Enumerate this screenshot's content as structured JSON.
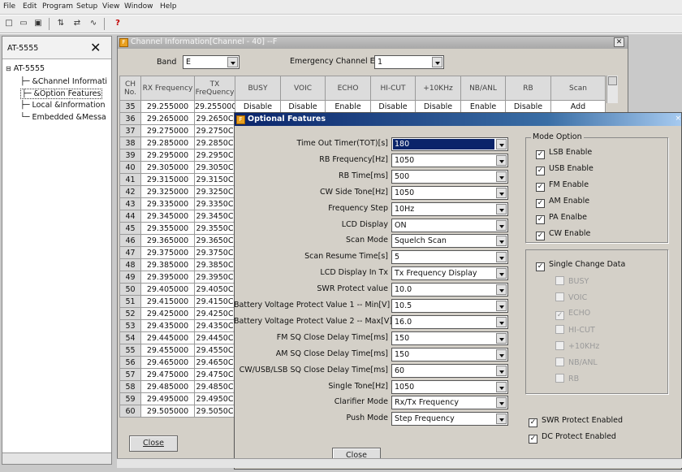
{
  "menu": [
    "File",
    "Edit",
    "Program",
    "Setup",
    "View",
    "Window",
    "Help"
  ],
  "toolbar_icons": [
    "new-icon",
    "open-icon",
    "save-icon",
    "read-icon",
    "write-icon",
    "wave-icon",
    "help-icon"
  ],
  "tree": {
    "title": "AT-5555",
    "root": "AT-5555",
    "items": [
      "&Channel Informati",
      "&Option Features",
      "Local &Information",
      "Embedded &Messa"
    ]
  },
  "channel_window": {
    "title": "Channel Information[Channel - 40] --F",
    "band_label": "Band",
    "band_value": "E",
    "emergency_label": "Emergency Channel E",
    "emergency_value": "1",
    "columns": [
      "CH No.",
      "RX Frequency",
      "TX FreQuency",
      "BUSY",
      "VOIC",
      "ECHO",
      "HI-CUT",
      "+10KHz",
      "NB/ANL",
      "RB",
      "Scan"
    ],
    "first_row_flags": [
      "Disable",
      "Disable",
      "Enable",
      "Disable",
      "Disable",
      "Enable",
      "Disable",
      "Add"
    ],
    "rows": [
      [
        "35",
        "29.255000",
        "29.255000"
      ],
      [
        "36",
        "29.265000",
        "29.2650C"
      ],
      [
        "37",
        "29.275000",
        "29.2750C"
      ],
      [
        "38",
        "29.285000",
        "29.2850C"
      ],
      [
        "39",
        "29.295000",
        "29.2950C"
      ],
      [
        "40",
        "29.305000",
        "29.3050C"
      ],
      [
        "41",
        "29.315000",
        "29.3150C"
      ],
      [
        "42",
        "29.325000",
        "29.3250C"
      ],
      [
        "43",
        "29.335000",
        "29.3350C"
      ],
      [
        "44",
        "29.345000",
        "29.3450C"
      ],
      [
        "45",
        "29.355000",
        "29.3550C"
      ],
      [
        "46",
        "29.365000",
        "29.3650C"
      ],
      [
        "47",
        "29.375000",
        "29.3750C"
      ],
      [
        "48",
        "29.385000",
        "29.3850C"
      ],
      [
        "49",
        "29.395000",
        "29.3950C"
      ],
      [
        "50",
        "29.405000",
        "29.4050C"
      ],
      [
        "51",
        "29.415000",
        "29.4150C"
      ],
      [
        "52",
        "29.425000",
        "29.4250C"
      ],
      [
        "53",
        "29.435000",
        "29.4350C"
      ],
      [
        "54",
        "29.445000",
        "29.4450C"
      ],
      [
        "55",
        "29.455000",
        "29.4550C"
      ],
      [
        "56",
        "29.465000",
        "29.4650C"
      ],
      [
        "57",
        "29.475000",
        "29.4750C"
      ],
      [
        "58",
        "29.485000",
        "29.4850C"
      ],
      [
        "59",
        "29.495000",
        "29.4950C"
      ],
      [
        "60",
        "29.505000",
        "29.5050C"
      ]
    ],
    "close_label": "Close"
  },
  "optional_features": {
    "title": "Optional Features",
    "fields": [
      {
        "label": "Time Out Timer(TOT)[s]",
        "value": "180"
      },
      {
        "label": "RB Frequency[Hz]",
        "value": "1050"
      },
      {
        "label": "RB Time[ms]",
        "value": "500"
      },
      {
        "label": "CW Side Tone[Hz]",
        "value": "1050"
      },
      {
        "label": "Frequency Step",
        "value": "10Hz"
      },
      {
        "label": "LCD Display",
        "value": "ON"
      },
      {
        "label": "Scan Mode",
        "value": "Squelch Scan"
      },
      {
        "label": "Scan Resume Time[s]",
        "value": "5"
      },
      {
        "label": "LCD Display In Tx",
        "value": "Tx Frequency Display"
      },
      {
        "label": "SWR Protect value",
        "value": "10.0"
      },
      {
        "label": "Battery Voltage Protect Value 1 -- Min[V]",
        "value": "10.5"
      },
      {
        "label": "Battery Voltage Protect Value 2 -- Max[V]",
        "value": "16.0"
      },
      {
        "label": "FM SQ Close Delay Time[ms]",
        "value": "150"
      },
      {
        "label": "AM SQ Close Delay Time[ms]",
        "value": "150"
      },
      {
        "label": "CW/USB/LSB SQ Close Delay Time[ms]",
        "value": "60"
      },
      {
        "label": "Single Tone[Hz]",
        "value": "1050"
      },
      {
        "label": "Clarifier Mode",
        "value": "Rx/Tx Frequency"
      },
      {
        "label": "Push Mode",
        "value": "Step Frequency"
      }
    ],
    "mode_option": {
      "title": "Mode Option",
      "items": [
        {
          "label": "LSB Enable",
          "checked": true
        },
        {
          "label": "USB Enable",
          "checked": true
        },
        {
          "label": "FM Enable",
          "checked": true
        },
        {
          "label": "AM Enable",
          "checked": true
        },
        {
          "label": "PA Enalbe",
          "checked": true
        },
        {
          "label": "CW Enable",
          "checked": true
        }
      ]
    },
    "single_change": {
      "label": "Single Change Data",
      "checked": true,
      "items": [
        {
          "label": "BUSY",
          "checked": false
        },
        {
          "label": "VOIC",
          "checked": false
        },
        {
          "label": "ECHO",
          "checked": true
        },
        {
          "label": "HI-CUT",
          "checked": false
        },
        {
          "label": "+10KHz",
          "checked": false
        },
        {
          "label": "NB/ANL",
          "checked": false
        },
        {
          "label": "RB",
          "checked": false
        }
      ]
    },
    "swr_protect": {
      "label": "SWR Protect Enabled",
      "checked": true
    },
    "dc_protect": {
      "label": "DC Protect Enabled",
      "checked": true
    },
    "close_label": "Close"
  },
  "colors": {
    "dialog_title": "#0a246a",
    "window_bg": "#d4d0c8",
    "selection": "#0a246a"
  }
}
